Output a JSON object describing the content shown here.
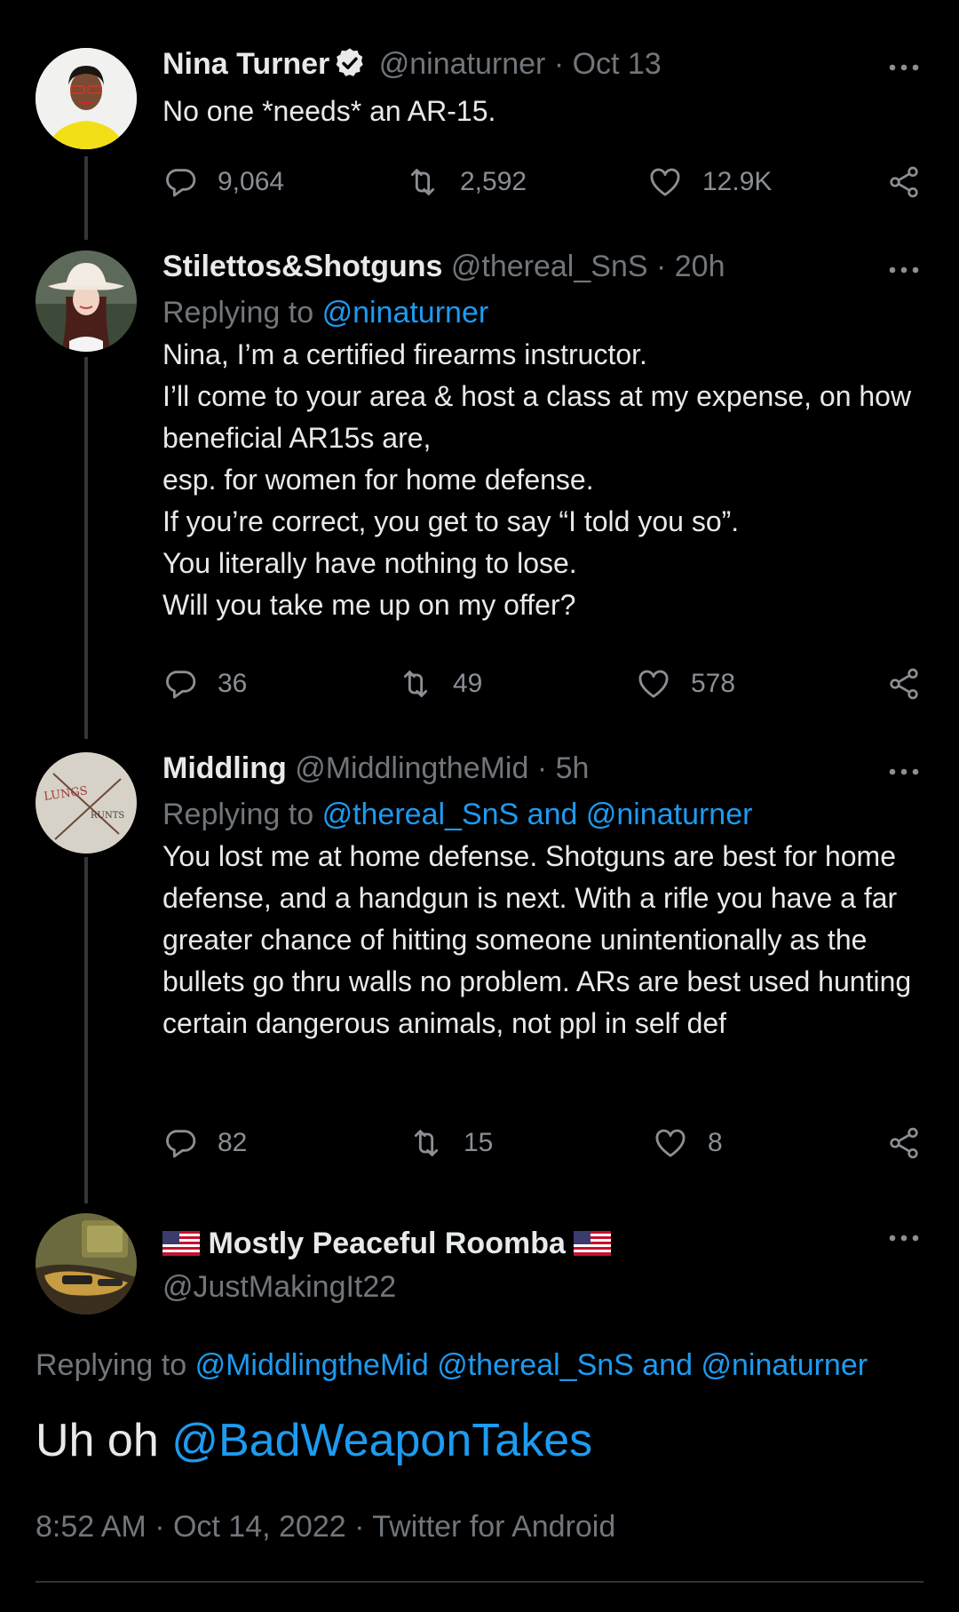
{
  "tweets": [
    {
      "name": "Nina Turner",
      "verified": true,
      "handle": "@ninaturner",
      "time": "· Oct 13",
      "text": "No one *needs* an AR-15.",
      "replies": "9,064",
      "retweets": "2,592",
      "likes": "12.9K"
    },
    {
      "name": "Stilettos&Shotguns",
      "handle": "@thereal_SnS",
      "time": "· 20h",
      "replying_prefix": "Replying to",
      "replying_to": "@ninaturner",
      "text": "Nina, I’m a certified firearms instructor.\nI’ll come to your area & host a class at my expense, on how beneficial AR15s are,\nesp. for women for home defense.\nIf you’re correct, you get to say “I told you so”.\nYou literally have nothing to lose.\nWill you take me up on my offer?",
      "replies": "36",
      "retweets": "49",
      "likes": "578"
    },
    {
      "name": "Middling",
      "handle": "@MiddlingtheMid",
      "time": "· 5h",
      "replying_prefix": "Replying to",
      "replying_to": "@thereal_SnS and @ninaturner",
      "text": "You lost me at home defense. Shotguns are best for home defense, and a handgun is next. With a rifle you have a far greater chance of hitting someone unintentionally as the bullets go thru walls no problem. ARs are best used hunting certain dangerous animals, not ppl in self def",
      "avatar_text_1": "LUNGS",
      "avatar_text_2": "RUNTS",
      "replies": "82",
      "retweets": "15",
      "likes": "8"
    }
  ],
  "main_tweet": {
    "name": "Mostly Peaceful Roomba",
    "handle": "@JustMakingIt22",
    "replying_prefix": "Replying to",
    "replying_to": "@MiddlingtheMid @thereal_SnS and @ninaturner",
    "text_plain": "Uh oh",
    "text_link": "@BadWeaponTakes",
    "meta": "8:52 AM · Oct 14, 2022 · Twitter for Android"
  },
  "colors": {
    "background": "#000000",
    "text": "#e7e9ea",
    "muted": "#71767b",
    "link": "#1d9bf0",
    "thread_line": "#333639"
  },
  "icons": [
    "reply-icon",
    "retweet-icon",
    "like-icon",
    "share-icon",
    "more-icon",
    "verified-badge-icon",
    "us-flag-icon"
  ]
}
